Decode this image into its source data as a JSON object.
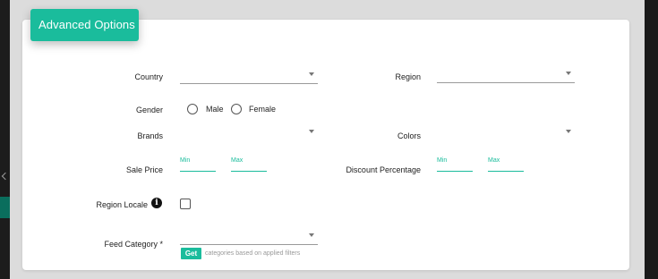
{
  "header": {
    "title": "Advanced Options"
  },
  "fields": {
    "country": {
      "label": "Country",
      "value": ""
    },
    "region": {
      "label": "Region",
      "value": ""
    },
    "gender": {
      "label": "Gender",
      "options": [
        "Male",
        "Female"
      ],
      "selected": null
    },
    "brands": {
      "label": "Brands",
      "value": ""
    },
    "colors": {
      "label": "Colors",
      "value": ""
    },
    "sale_price": {
      "label": "Sale Price",
      "min_placeholder": "Min",
      "max_placeholder": "Max"
    },
    "discount_percentage": {
      "label": "Discount Percentage",
      "min_placeholder": "Min",
      "max_placeholder": "Max"
    },
    "region_locale": {
      "label": "Region Locale",
      "checked": false
    },
    "feed_category": {
      "label": "Feed Category *",
      "value": "",
      "get_label": "Get",
      "hint": "categories based on applied filters"
    }
  },
  "colors": {
    "accent": "#1abc9c"
  },
  "icons": {
    "info": "info-icon",
    "dropdown": "chevron-down-icon"
  }
}
